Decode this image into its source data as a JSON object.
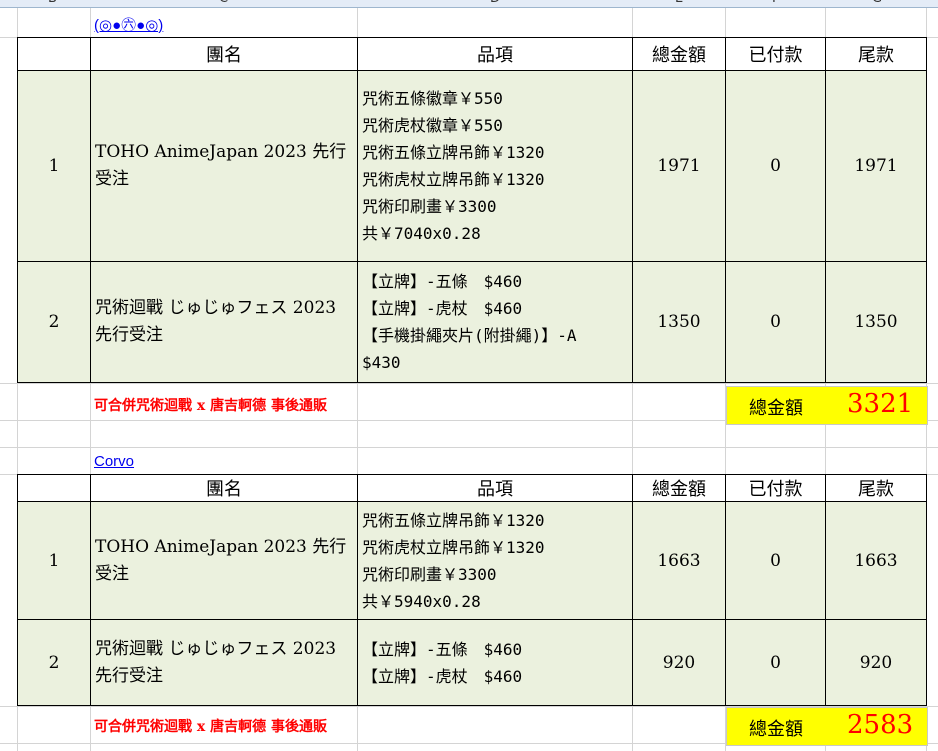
{
  "columns": [
    "B",
    "C",
    "D",
    "E",
    "F",
    "G"
  ],
  "blocks": [
    {
      "user": "(◎●㊅●◎)",
      "header": [
        "團名",
        "品項",
        "總金額",
        "已付款",
        "尾款"
      ],
      "rows": [
        {
          "no": "1",
          "group": "TOHO AnimeJapan 2023 先行受注",
          "items": [
            "咒術五條徽章￥550",
            "咒術虎杖徽章￥550",
            "咒術五條立牌吊飾￥1320",
            "咒術虎杖立牌吊飾￥1320",
            "咒術印刷畫￥3300",
            "共￥7040x0.28"
          ],
          "total": "1971",
          "paid": "0",
          "balance": "1971"
        },
        {
          "no": "2",
          "group": "咒術迴戰 じゅじゅフェス 2023 先行受注",
          "items": [
            "【立牌】-五條　$460",
            "【立牌】-虎杖　$460",
            "【手機掛繩夾片(附掛繩)】-A",
            "$430"
          ],
          "total": "1350",
          "paid": "0",
          "balance": "1350"
        }
      ],
      "note": "可合併咒術迴戰 x 唐吉軻德 事後通販",
      "total_label": "總金額",
      "total_value": "3321"
    },
    {
      "user": "Corvo",
      "header": [
        "團名",
        "品項",
        "總金額",
        "已付款",
        "尾款"
      ],
      "rows": [
        {
          "no": "1",
          "group": "TOHO AnimeJapan 2023 先行受注",
          "items": [
            "咒術五條立牌吊飾￥1320",
            "咒術虎杖立牌吊飾￥1320",
            "咒術印刷畫￥3300",
            "共￥5940x0.28"
          ],
          "total": "1663",
          "paid": "0",
          "balance": "1663"
        },
        {
          "no": "2",
          "group": "咒術迴戰 じゅじゅフェス 2023 先行受注",
          "items": [
            "【立牌】-五條　$460",
            "【立牌】-虎杖　$460"
          ],
          "total": "920",
          "paid": "0",
          "balance": "920"
        }
      ],
      "note": "可合併咒術迴戰 x 唐吉軻德 事後通販",
      "total_label": "總金額",
      "total_value": "2583"
    }
  ]
}
